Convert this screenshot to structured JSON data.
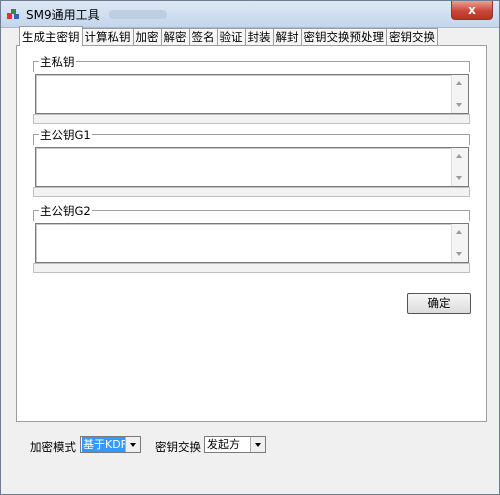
{
  "window": {
    "title": "SM9通用工具",
    "close_label": "x"
  },
  "tabs": [
    {
      "label": "生成主密钥"
    },
    {
      "label": "计算私钥"
    },
    {
      "label": "加密"
    },
    {
      "label": "解密"
    },
    {
      "label": "签名"
    },
    {
      "label": "验证"
    },
    {
      "label": "封装"
    },
    {
      "label": "解封"
    },
    {
      "label": "密钥交换预处理"
    },
    {
      "label": "密钥交换"
    }
  ],
  "groups": [
    {
      "label": "主私钥",
      "value": ""
    },
    {
      "label": "主公钥G1",
      "value": ""
    },
    {
      "label": "主公钥G2",
      "value": ""
    }
  ],
  "confirm_label": "确定",
  "bottom": {
    "mode_label": "加密模式",
    "mode_value": "基于KDF",
    "exchange_label": "密钥交换",
    "exchange_value": "发起方"
  },
  "colors": {
    "selection": "#3399ff",
    "close": "#c9473a"
  }
}
